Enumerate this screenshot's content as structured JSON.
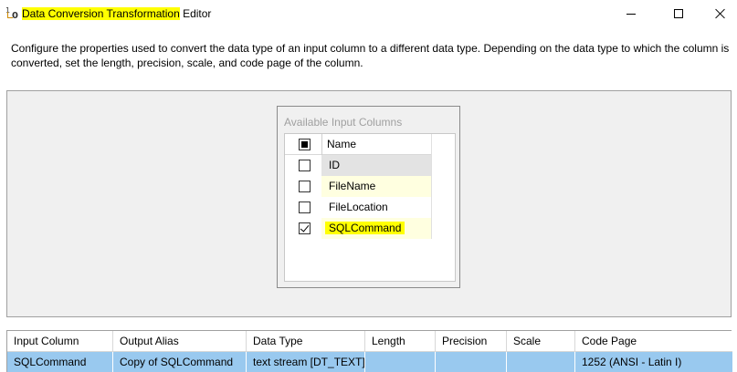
{
  "window": {
    "title_highlighted": "Data Conversion Transformation",
    "title_rest": " Editor",
    "icon": "data-conversion-icon"
  },
  "description": "Configure the properties used to convert the data type of an input column to a different data type. Depending on the data type to which the column is converted, set the length, precision, scale, and code page of the column.",
  "available_columns": {
    "title": "Available Input Columns",
    "header_label": "Name",
    "items": [
      {
        "label": "ID",
        "checked": false
      },
      {
        "label": "FileName",
        "checked": false
      },
      {
        "label": "FileLocation",
        "checked": false
      },
      {
        "label": "SQLCommand",
        "checked": true,
        "highlighted": true
      }
    ]
  },
  "grid": {
    "headers": [
      "Input Column",
      "Output Alias",
      "Data Type",
      "Length",
      "Precision",
      "Scale",
      "Code Page"
    ],
    "rows": [
      [
        "SQLCommand",
        "Copy of SQLCommand",
        "text stream [DT_TEXT]",
        "",
        "",
        "",
        "1252  (ANSI - Latin I)"
      ]
    ]
  },
  "colors": {
    "highlight": "#ffff00",
    "selected_row": "#99c9ef",
    "designer_bg": "#f0f0f0"
  }
}
